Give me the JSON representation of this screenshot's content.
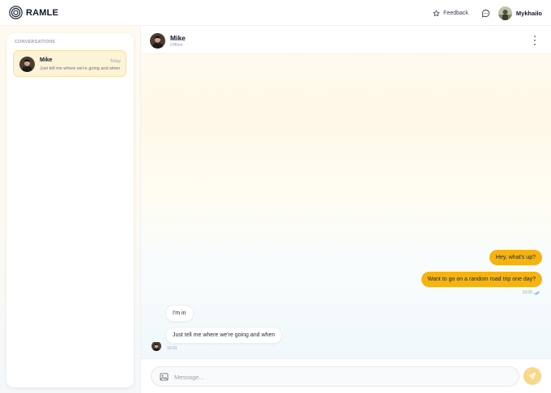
{
  "brand": {
    "name": "RAMLE"
  },
  "topbar": {
    "feedback_label": "Feedback",
    "user_name": "Mykhailo"
  },
  "sidebar": {
    "title": "CONVERSATIONS",
    "conversations": [
      {
        "name": "Mike",
        "time": "Today",
        "preview": "Just tell me where we're going and when"
      }
    ]
  },
  "chat": {
    "contact_name": "Mike",
    "contact_status": "Offline",
    "messages_out": [
      {
        "text": "Hey, what's up?"
      },
      {
        "text": "Want to go on a random road trip one day?"
      }
    ],
    "out_time": "10:00",
    "messages_in": [
      {
        "text": "I'm in"
      },
      {
        "text": "Just tell me where we're going and when"
      }
    ],
    "in_time": "10:01"
  },
  "composer": {
    "placeholder": "Message..."
  },
  "colors": {
    "accent": "#f5b311",
    "selected_conversation_bg": "#fdf3d6",
    "send_button": "#f8d88a"
  },
  "icons": [
    "logo-spiral-icon",
    "star-icon",
    "chat-bubble-icon",
    "more-vertical-icon",
    "image-icon",
    "send-icon",
    "double-check-icon"
  ]
}
